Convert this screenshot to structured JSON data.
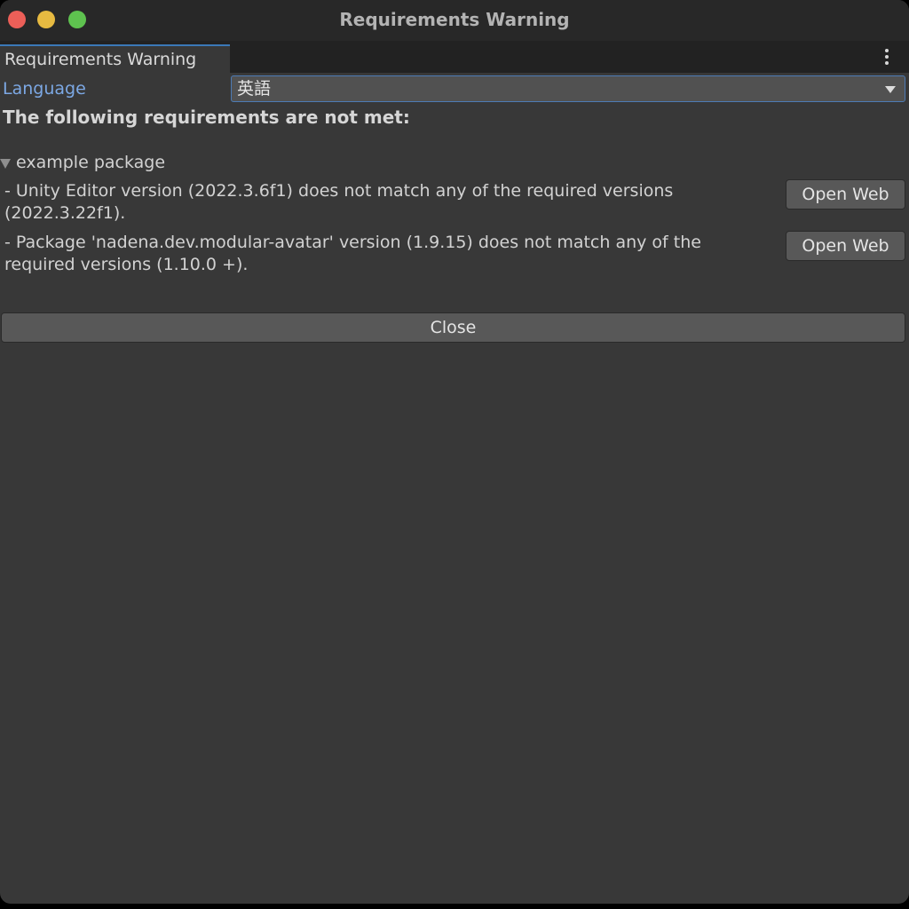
{
  "window": {
    "title": "Requirements Warning"
  },
  "tab": {
    "label": "Requirements Warning",
    "menu_icon": "more-vertical-icon"
  },
  "language": {
    "label": "Language",
    "selected": "英語"
  },
  "heading": "The following requirements are not met:",
  "package": {
    "name": "example package",
    "expanded": true,
    "requirements": [
      {
        "text": "- Unity Editor version (2022.3.6f1) does not match any of the required versions (2022.3.22f1).",
        "button": "Open Web"
      },
      {
        "text": "- Package 'nadena.dev.modular-avatar' version (1.9.15) does not match any of the required versions (1.10.0 +).",
        "button": "Open Web"
      }
    ]
  },
  "close_label": "Close",
  "colors": {
    "window_bg": "#383838",
    "titlebar_bg": "#282828",
    "accent": "#3b78b8",
    "label_blue": "#7ca8e4",
    "close_red": "#ec5f58",
    "minimize_yellow": "#e7ba41",
    "maximize_green": "#5ec24f"
  }
}
